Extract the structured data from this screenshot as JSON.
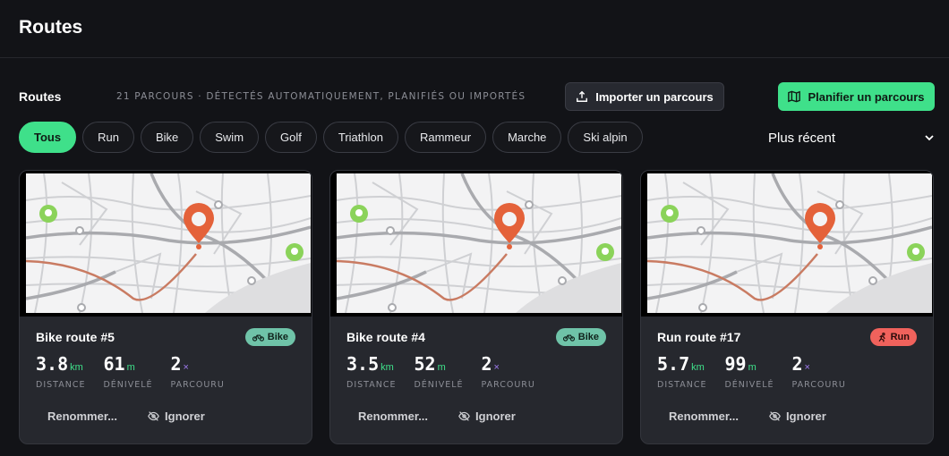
{
  "header": {
    "title": "Routes"
  },
  "section": {
    "title": "Routes",
    "subtitle": "21 PARCOURS · DÉTECTÉS AUTOMATIQUEMENT, PLANIFIÉS OU IMPORTÉS",
    "import_label": "Importer un parcours",
    "plan_label": "Planifier un parcours"
  },
  "filters": [
    "Tous",
    "Run",
    "Bike",
    "Swim",
    "Golf",
    "Triathlon",
    "Rammeur",
    "Marche",
    "Ski alpin"
  ],
  "sort": {
    "selected": "Plus récent"
  },
  "cards": [
    {
      "title": "Bike route #5",
      "badge": "Bike",
      "distance": "3.8",
      "distance_unit": "km",
      "elevation": "61",
      "elevation_unit": "m",
      "routes": "2",
      "routes_unit": "×"
    },
    {
      "title": "Bike route #4",
      "badge": "Bike",
      "distance": "3.5",
      "distance_unit": "km",
      "elevation": "52",
      "elevation_unit": "m",
      "routes": "2",
      "routes_unit": "×"
    },
    {
      "title": "Run route #17",
      "badge": "Run",
      "distance": "5.7",
      "distance_unit": "km",
      "elevation": "99",
      "elevation_unit": "m",
      "routes": "2",
      "routes_unit": "×"
    }
  ],
  "labels": {
    "distance": "DISTANCE",
    "elevation": "DÉNIVELÉ",
    "routes": "PARCOURU",
    "rename": "Renommer...",
    "ignore": "Ignorer"
  },
  "colors": {
    "accent": "#3fe08a",
    "bike": "#6fc3a8",
    "run": "#f0625c",
    "pin": "#e4623a"
  }
}
